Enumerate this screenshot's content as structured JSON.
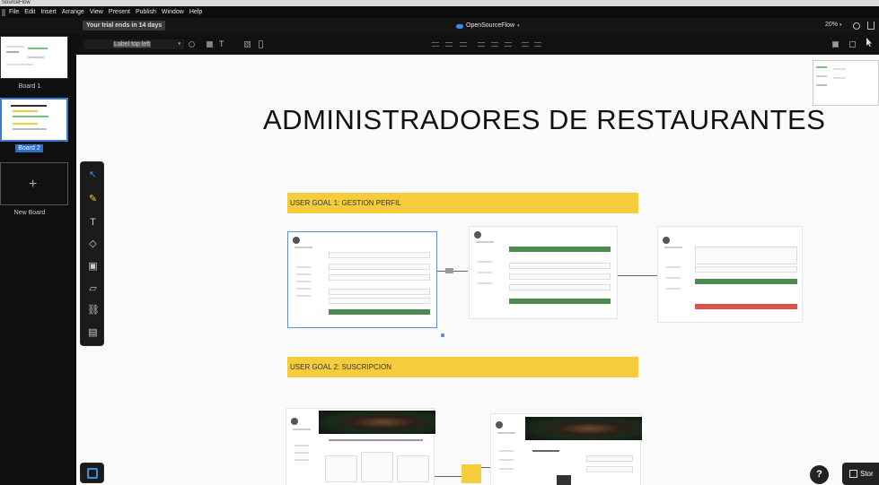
{
  "window": {
    "title": "SourceFlow"
  },
  "menu": [
    "File",
    "Edit",
    "Insert",
    "Arrange",
    "View",
    "Present",
    "Publish",
    "Window",
    "Help"
  ],
  "header": {
    "trial": "Your trial ends in 14 days",
    "doc_title": "OpenSourceFlow",
    "doc_caret": "▾",
    "zoom": "20%",
    "zoom_caret": "▾"
  },
  "toolbar": {
    "text_style": "Label top left",
    "caret": "▾"
  },
  "boards": [
    {
      "label": "Board 1",
      "selected": false
    },
    {
      "label": "Board 2",
      "selected": true
    }
  ],
  "new_board": {
    "label": "New Board",
    "plus": "+"
  },
  "canvas": {
    "title": "ADMINISTRADORES DE RESTAURANTES",
    "goal1": "USER GOAL 1: GESTION PERFIL",
    "goal2": "USER GOAL 2: SUSCRIPCION"
  },
  "tools": [
    {
      "name": "pointer-tool",
      "glyph": "↖"
    },
    {
      "name": "pen-tool",
      "glyph": "✎"
    },
    {
      "name": "text-tool",
      "glyph": "T"
    },
    {
      "name": "shapes-tool",
      "glyph": "◇"
    },
    {
      "name": "image-tool",
      "glyph": "▣"
    },
    {
      "name": "sticky-tool",
      "glyph": "▱"
    },
    {
      "name": "link-tool",
      "glyph": "⛓"
    },
    {
      "name": "component-tool",
      "glyph": "▤"
    }
  ],
  "help": "?",
  "store": "Stor"
}
